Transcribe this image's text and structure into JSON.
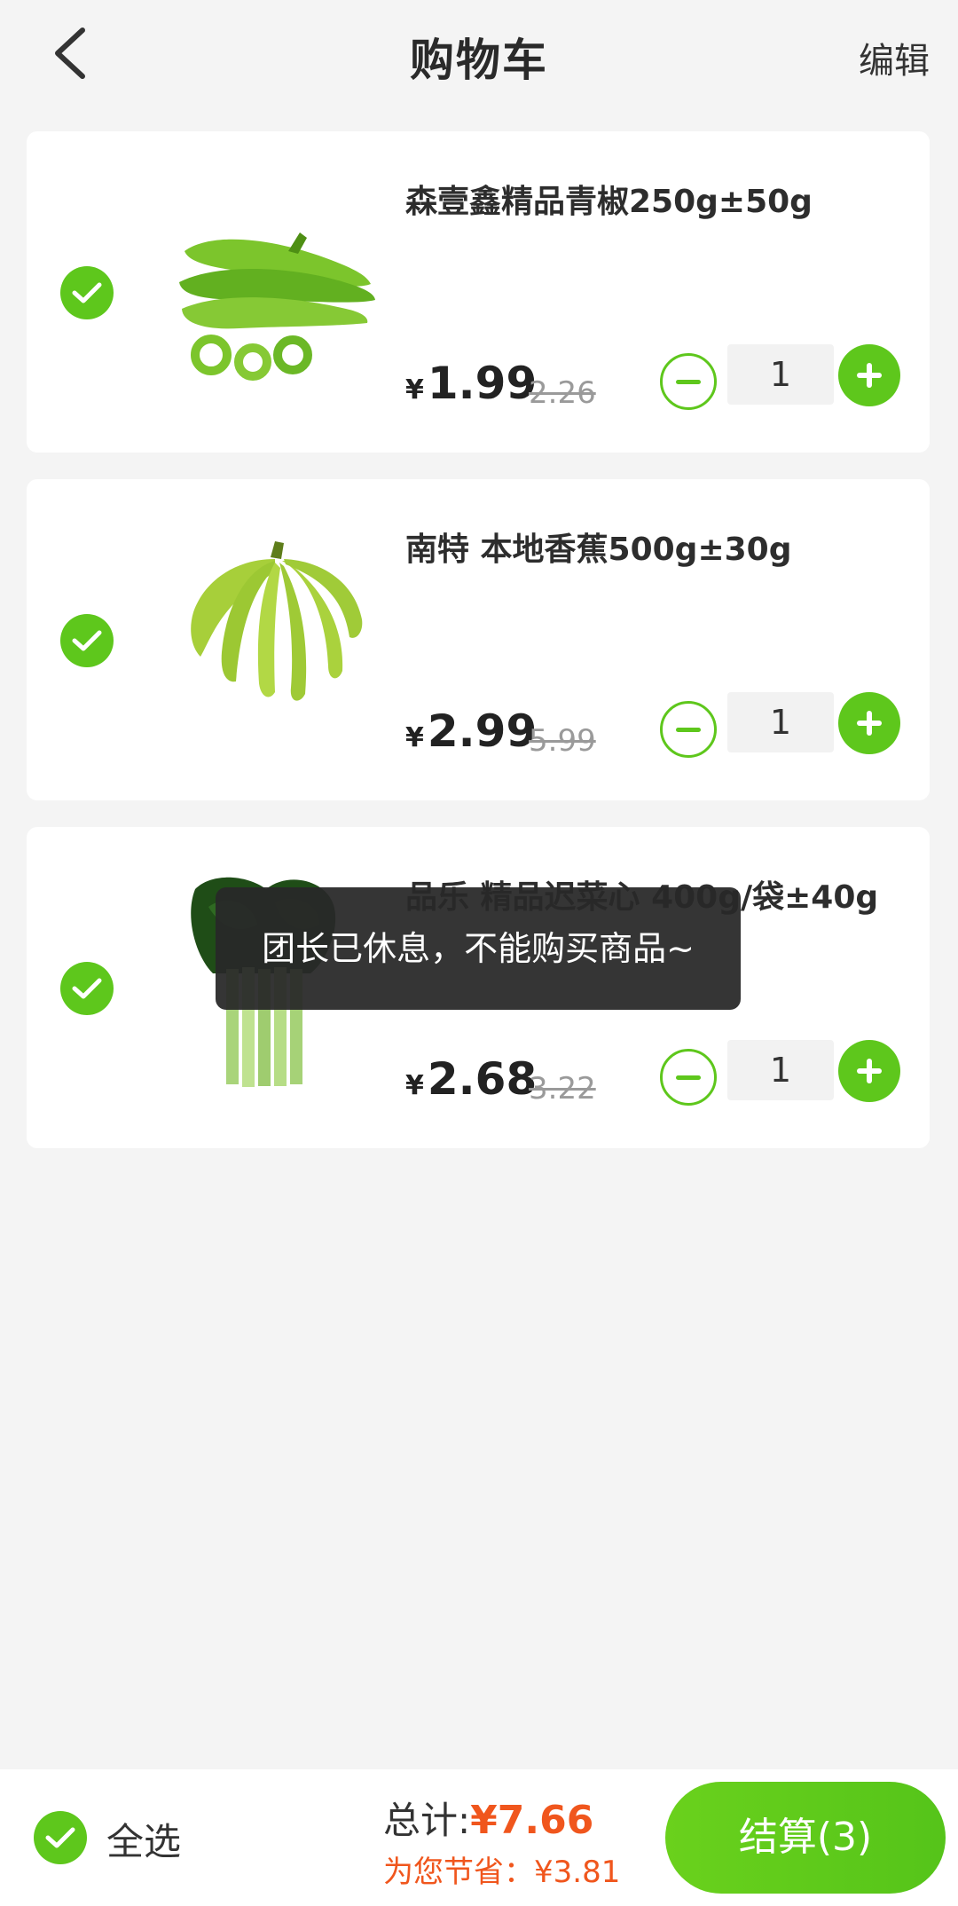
{
  "header": {
    "title": "购物车",
    "edit_label": "编辑"
  },
  "items": [
    {
      "name": "森壹鑫精品青椒250g±50g",
      "price_symbol": "¥",
      "price": "1.99",
      "original_price": "2.26",
      "quantity": "1",
      "image": "green-pepper"
    },
    {
      "name": "南特 本地香蕉500g±30g",
      "price_symbol": "¥",
      "price": "2.99",
      "original_price": "5.99",
      "quantity": "1",
      "image": "banana"
    },
    {
      "name": "品乐 精品迟菜心 400g/袋±40g",
      "price_symbol": "¥",
      "price": "2.68",
      "original_price": "3.22",
      "quantity": "1",
      "image": "choy-sum"
    }
  ],
  "toast": "团长已休息，不能购买商品~",
  "footer": {
    "select_all_label": "全选",
    "total_label": "总计:",
    "total_amount": "¥7.66",
    "savings_text": "为您节省：¥3.81",
    "checkout_label": "结算(3)"
  },
  "colors": {
    "accent": "#5ec71c",
    "price_highlight": "#f0561d",
    "background": "#f4f4f4"
  }
}
